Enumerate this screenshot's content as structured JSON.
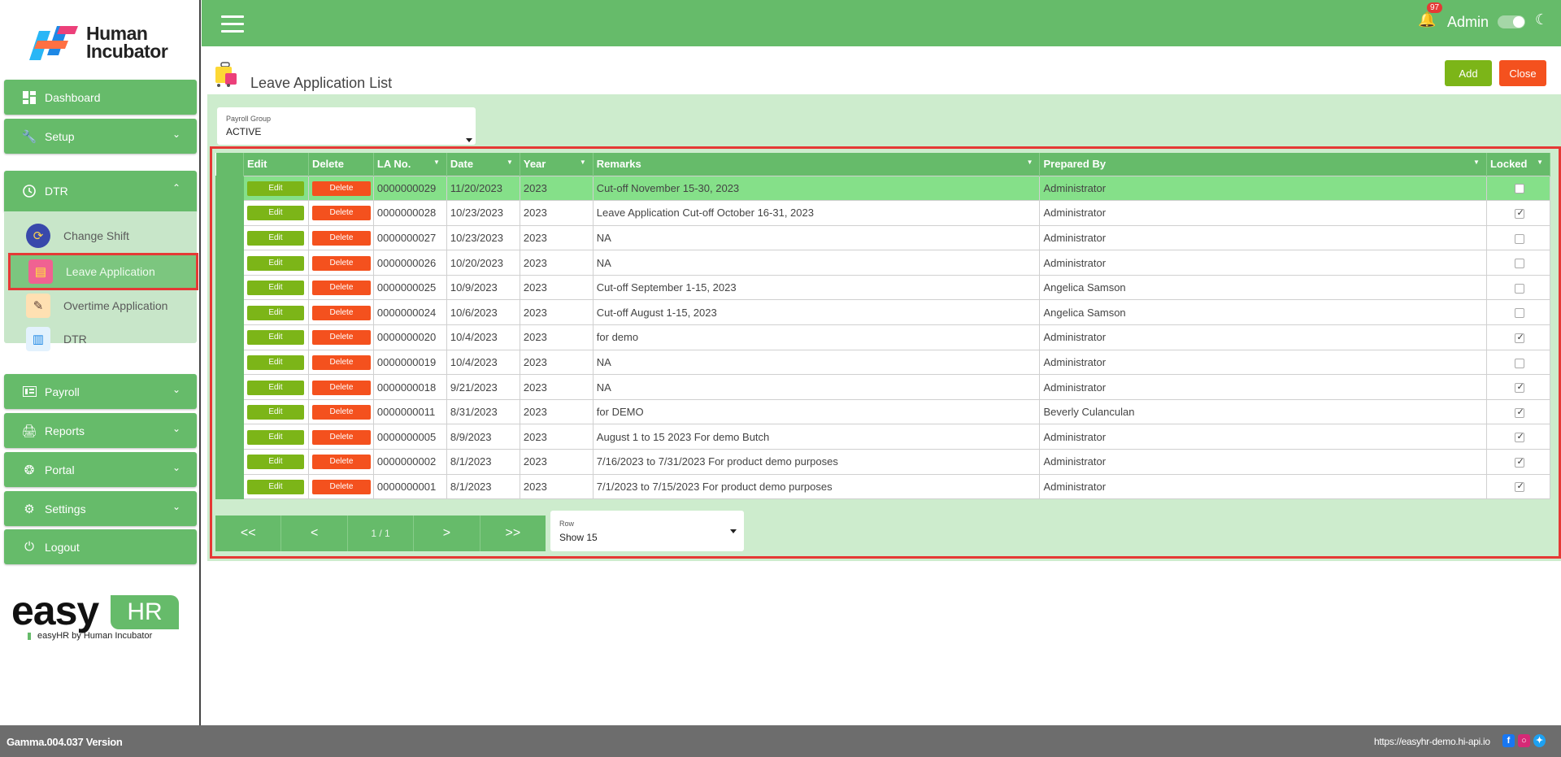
{
  "brand": {
    "name_line1": "Human",
    "name_line2": "Incubator"
  },
  "sidebar": {
    "items": [
      {
        "label": "Dashboard",
        "icon": "dashboard-icon"
      },
      {
        "label": "Setup",
        "icon": "wrench-icon"
      },
      {
        "label": "DTR",
        "icon": "clock-icon"
      },
      {
        "label": "Payroll",
        "icon": "payroll-icon"
      },
      {
        "label": "Reports",
        "icon": "printer-icon"
      },
      {
        "label": "Portal",
        "icon": "aperture-icon"
      },
      {
        "label": "Settings",
        "icon": "gear-icon"
      },
      {
        "label": "Logout",
        "icon": "power-icon"
      }
    ],
    "dtr_sub": [
      {
        "label": "Change Shift",
        "icon": "change-shift-icon"
      },
      {
        "label": "Leave Application",
        "icon": "luggage-icon",
        "active": true
      },
      {
        "label": "Overtime Application",
        "icon": "overtime-icon"
      },
      {
        "label": "DTR",
        "icon": "dtr-card-icon"
      }
    ]
  },
  "easyhr": {
    "word": "easy",
    "hr": "HR",
    "tagline": "easyHR by Human Incubator"
  },
  "topbar": {
    "notification_count": "97",
    "user": "Admin"
  },
  "page": {
    "title": "Leave Application List",
    "add_label": "Add",
    "close_label": "Close",
    "payroll_group": {
      "label": "Payroll Group",
      "value": "ACTIVE"
    }
  },
  "table": {
    "headers": [
      "Edit",
      "Delete",
      "LA No.",
      "Date",
      "Year",
      "Remarks",
      "Prepared By",
      "Locked"
    ],
    "edit_label": "Edit",
    "delete_label": "Delete",
    "rows": [
      {
        "la_no": "0000000029",
        "date": "11/20/2023",
        "year": "2023",
        "remarks": "Cut-off November 15-30, 2023",
        "prepared_by": "Administrator",
        "locked": false
      },
      {
        "la_no": "0000000028",
        "date": "10/23/2023",
        "year": "2023",
        "remarks": "Leave Application Cut-off October 16-31, 2023",
        "prepared_by": "Administrator",
        "locked": true
      },
      {
        "la_no": "0000000027",
        "date": "10/23/2023",
        "year": "2023",
        "remarks": "NA",
        "prepared_by": "Administrator",
        "locked": false
      },
      {
        "la_no": "0000000026",
        "date": "10/20/2023",
        "year": "2023",
        "remarks": "NA",
        "prepared_by": "Administrator",
        "locked": false
      },
      {
        "la_no": "0000000025",
        "date": "10/9/2023",
        "year": "2023",
        "remarks": "Cut-off September 1-15, 2023",
        "prepared_by": "Angelica Samson",
        "locked": false
      },
      {
        "la_no": "0000000024",
        "date": "10/6/2023",
        "year": "2023",
        "remarks": "Cut-off August 1-15, 2023",
        "prepared_by": "Angelica Samson",
        "locked": false
      },
      {
        "la_no": "0000000020",
        "date": "10/4/2023",
        "year": "2023",
        "remarks": "for demo",
        "prepared_by": "Administrator",
        "locked": true
      },
      {
        "la_no": "0000000019",
        "date": "10/4/2023",
        "year": "2023",
        "remarks": "NA",
        "prepared_by": "Administrator",
        "locked": false
      },
      {
        "la_no": "0000000018",
        "date": "9/21/2023",
        "year": "2023",
        "remarks": "NA",
        "prepared_by": "Administrator",
        "locked": true
      },
      {
        "la_no": "0000000011",
        "date": "8/31/2023",
        "year": "2023",
        "remarks": "for DEMO",
        "prepared_by": "Beverly Culanculan",
        "locked": true
      },
      {
        "la_no": "0000000005",
        "date": "8/9/2023",
        "year": "2023",
        "remarks": "August 1 to 15 2023 For demo Butch",
        "prepared_by": "Administrator",
        "locked": true
      },
      {
        "la_no": "0000000002",
        "date": "8/1/2023",
        "year": "2023",
        "remarks": "7/16/2023 to 7/31/2023 For product demo purposes",
        "prepared_by": "Administrator",
        "locked": true
      },
      {
        "la_no": "0000000001",
        "date": "8/1/2023",
        "year": "2023",
        "remarks": "7/1/2023 to 7/15/2023 For product demo purposes",
        "prepared_by": "Administrator",
        "locked": true
      }
    ]
  },
  "pager": {
    "first": "<<",
    "prev": "<",
    "page": "1 / 1",
    "next": ">",
    "last": ">>"
  },
  "row_select": {
    "label": "Row",
    "value": "Show 15"
  },
  "footer": {
    "version": "Gamma.004.037 Version",
    "url": "https://easyhr-demo.hi-api.io"
  },
  "colors": {
    "primary": "#66bb6a",
    "add": "#7cb518",
    "close": "#f4511e",
    "highlight": "#e53935"
  }
}
